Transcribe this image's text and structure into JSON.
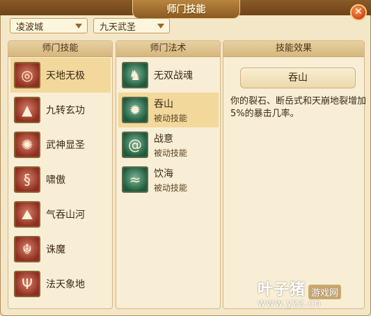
{
  "window": {
    "title": "师门技能"
  },
  "filters": {
    "city": "凌波城",
    "sect_skill": "九天武圣"
  },
  "panels": {
    "sect_skills": {
      "header": "师门技能",
      "items": [
        {
          "label": "天地无极",
          "icon": "vortex-icon",
          "selected": true
        },
        {
          "label": "九转玄功",
          "icon": "flame-pillar-icon"
        },
        {
          "label": "武神显圣",
          "icon": "burst-icon"
        },
        {
          "label": "啸傲",
          "icon": "dragon-icon"
        },
        {
          "label": "气吞山河",
          "icon": "mountain-icon"
        },
        {
          "label": "诛魔",
          "icon": "demon-icon"
        },
        {
          "label": "法天象地",
          "icon": "trident-icon"
        }
      ]
    },
    "sect_spells": {
      "header": "师门法术",
      "items": [
        {
          "label": "无双战魂",
          "sub": "",
          "icon": "warrior-spirit-icon"
        },
        {
          "label": "吞山",
          "sub": "被动技能",
          "icon": "spike-burst-icon",
          "selected": true
        },
        {
          "label": "战意",
          "sub": "被动技能",
          "icon": "swirl-icon"
        },
        {
          "label": "饮海",
          "sub": "被动技能",
          "icon": "wave-icon"
        }
      ]
    },
    "effect": {
      "header": "技能效果",
      "name": "吞山",
      "description": "你的裂石、断岳式和天崩地裂增加5%的暴击几率。"
    }
  },
  "watermark": {
    "main": "叶子猪",
    "tag": "游戏网",
    "url": "www.yzz.cn"
  },
  "colors": {
    "title_bar": "#7a4c1e",
    "selected_row": "#f2d89b",
    "panel_bg": "#f8eed5"
  }
}
